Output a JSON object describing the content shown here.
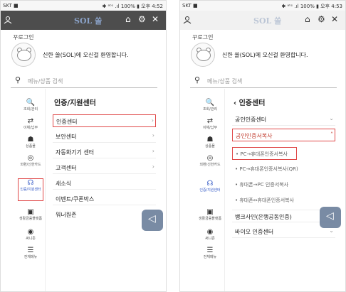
{
  "left": {
    "status_left": "SKT ■",
    "status_right": "✱ ᵃᵗᵉ .ıl 100% ▮ 오후 4:52",
    "logo": "SOL 쏠",
    "login": "꾸로그인",
    "welcome": "신한 쏠(SOL)에 오신걸 환영합니다.",
    "search_placeholder": "메뉴/상품 검색",
    "sidebar": [
      "조회/관리",
      "이체/납부",
      "상품몰",
      "외환/신한카드",
      "인증/지원센터",
      "생활금융플랫폼",
      "써니존",
      "전체메뉴"
    ],
    "menu_title": "인증/지원센터",
    "menu_items": [
      "인증센터",
      "보안센터",
      "자동화기기 센터",
      "고객센터",
      "새소식",
      "이벤트/쿠폰박스",
      "워너원존"
    ]
  },
  "right": {
    "status_left": "SKT ■",
    "status_right": "✱ ᵃᵗᵉ .ıl 100% ▮ 오후 4:53",
    "logo": "SOL 쏠",
    "login": "꾸로그인",
    "welcome": "신한 쏠(SOL)에 오신걸 환영합니다.",
    "search_placeholder": "메뉴/상품 검색",
    "sidebar": [
      "조회/관리",
      "이체/납부",
      "상품몰",
      "외환/신한카드",
      "인증/지원센터",
      "생활금융플랫폼",
      "써니존",
      "전체메뉴"
    ],
    "menu_title": "인증센터",
    "row_1": "공인인증센터",
    "row_2": "공인인증서복사",
    "subs": [
      "• PC→휴대폰인증서복사",
      "• PC→휴대폰인증서복사(QR)",
      "• 휴대폰→PC 인증서복사",
      "• 휴대폰↔휴대폰인증서복사"
    ],
    "row_3": "뱅크사인(은행공동인증)",
    "row_4": "바이오 인증센터"
  }
}
